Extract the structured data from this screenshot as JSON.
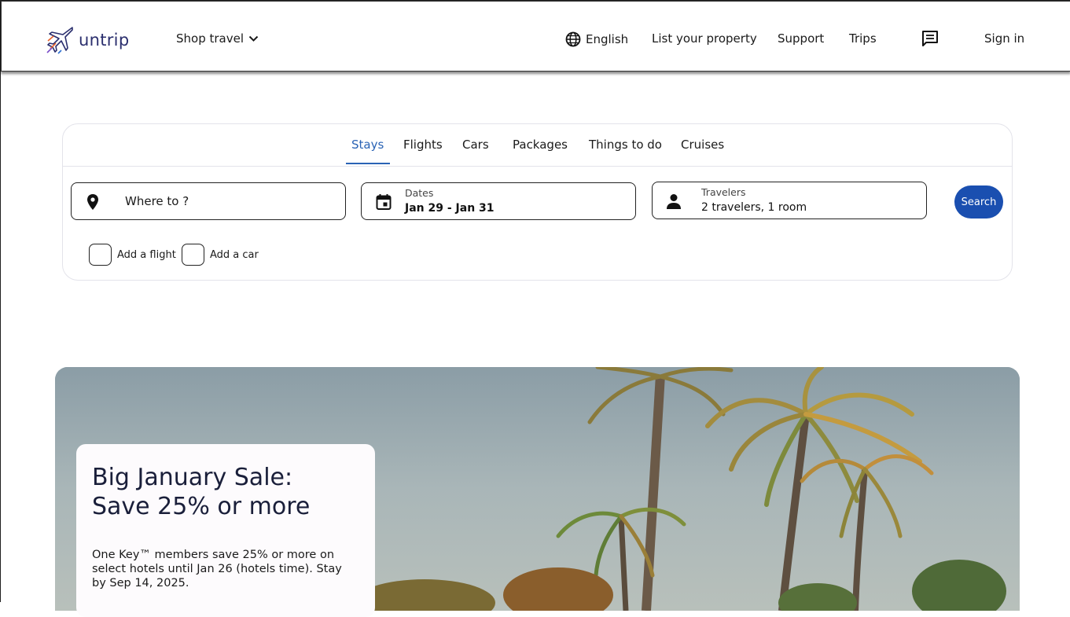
{
  "brand": {
    "name": "untrip"
  },
  "header": {
    "shop_travel": "Shop travel",
    "language": "English",
    "list_property": "List your property",
    "support": "Support",
    "trips": "Trips",
    "sign_in": "Sign in"
  },
  "tabs": [
    {
      "label": "Stays",
      "active": true
    },
    {
      "label": "Flights",
      "active": false
    },
    {
      "label": "Cars",
      "active": false
    },
    {
      "label": "Packages",
      "active": false
    },
    {
      "label": "Things to do",
      "active": false
    },
    {
      "label": "Cruises",
      "active": false
    }
  ],
  "search": {
    "where_placeholder": "Where to ?",
    "dates_label": "Dates",
    "dates_value": "Jan 29 - Jan 31",
    "travelers_label": "Travelers",
    "travelers_value": "2 travelers, 1 room",
    "button": "Search"
  },
  "addons": {
    "flight": "Add a flight",
    "car": "Add a car"
  },
  "promo": {
    "title_line1": "Big January Sale:",
    "title_line2": "Save 25% or more",
    "body": "One Key™ members save 25% or more on select hotels until Jan 26 (hotels time). Stay by Sep 14, 2025."
  },
  "colors": {
    "accent": "#2a63b5",
    "search_button": "#1a4fb0",
    "brand_text": "#2b2f6e"
  },
  "icons": {
    "logo": "airplane-logo-icon",
    "shop_travel": "chevron-down-icon",
    "language": "globe-icon",
    "chat": "chat-icon",
    "where": "map-pin-icon",
    "dates": "calendar-icon",
    "travelers": "person-icon"
  }
}
